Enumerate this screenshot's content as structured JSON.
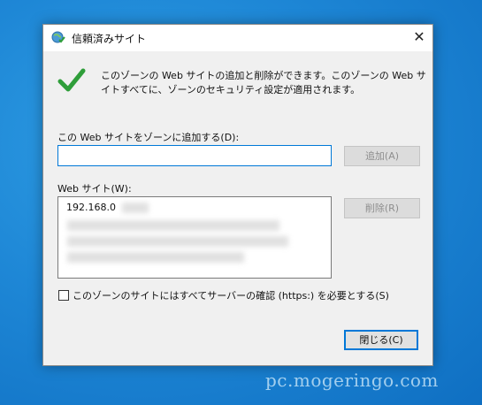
{
  "dialog": {
    "title": "信頼済みサイト",
    "close_glyph": "✕",
    "description": "このゾーンの Web サイトの追加と削除ができます。このゾーンの Web サイトすべてに、ゾーンのセキュリティ設定が適用されます。",
    "add_label": "この Web サイトをゾーンに追加する(D):",
    "add_input_value": "",
    "add_button": "追加(A)",
    "sites_label": "Web サイト(W):",
    "sites": [
      "192.168.0"
    ],
    "remove_button": "削除(R)",
    "https_checkbox_label": "このゾーンのサイトにはすべてサーバーの確認 (https:) を必要とする(S)",
    "https_checked": false,
    "close_button": "閉じる(C)"
  },
  "watermark": "pc.mogeringo.com",
  "colors": {
    "accent": "#0078d7",
    "check_green": "#2f9e3a",
    "desktop": "#1e87d6"
  }
}
